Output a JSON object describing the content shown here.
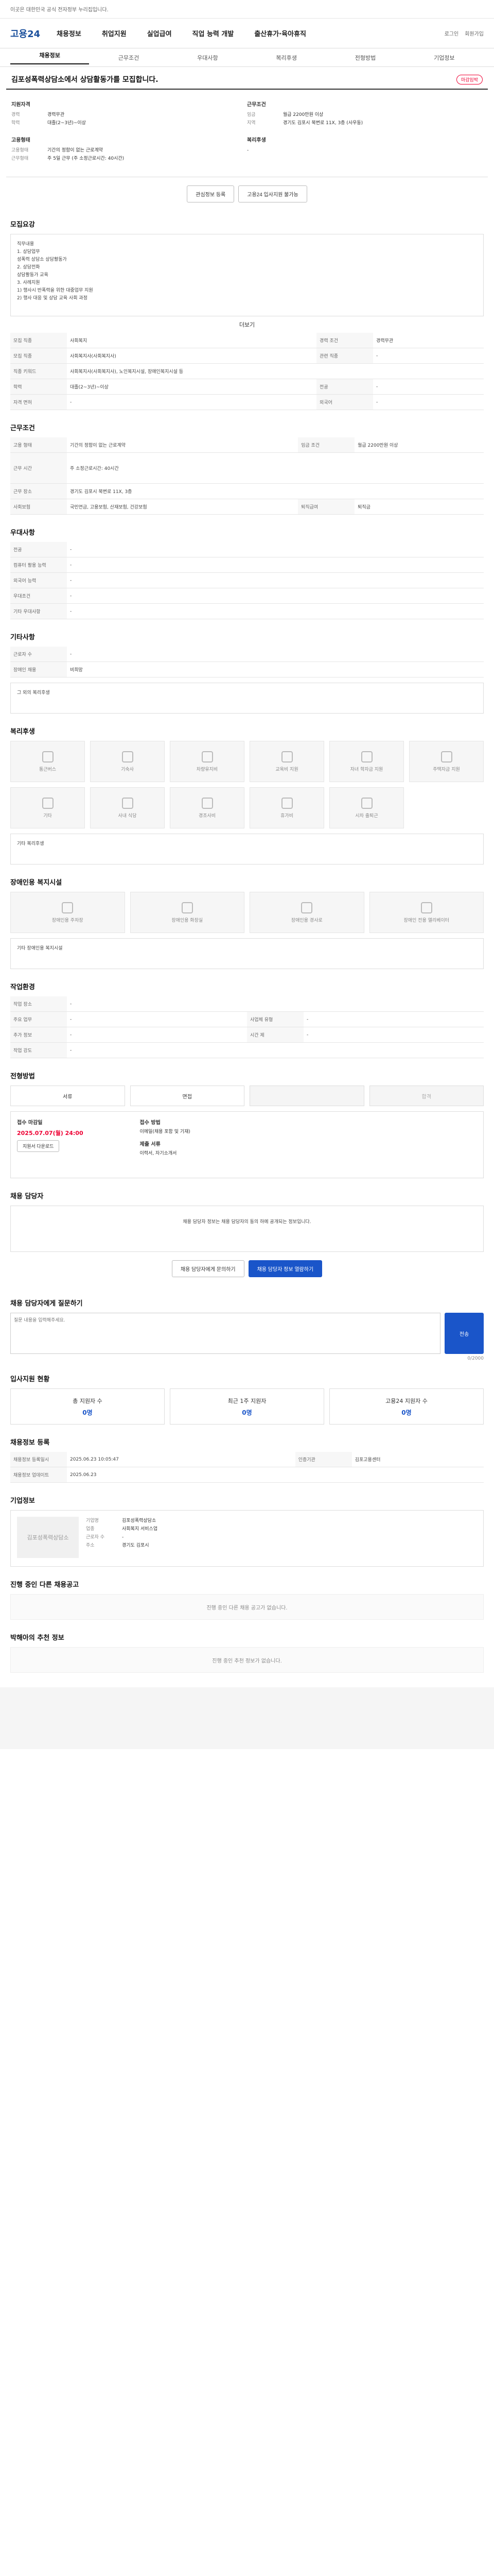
{
  "topbar": {
    "notice": "이곳은 대한민국 공식 전자정부 누리집입니다."
  },
  "site": {
    "logo": "고용24",
    "gnb": [
      "채용정보",
      "취업지원",
      "실업급여",
      "직업 능력 개발",
      "출산휴가·육아휴직"
    ],
    "links": [
      "로그인",
      "회원가입"
    ]
  },
  "tabs": [
    "채용정보",
    "근무조건",
    "우대사항",
    "복리후생",
    "전형방법",
    "기업정보"
  ],
  "job": {
    "title": "김포성폭력상담소에서 상담활동가를 모집합니다.",
    "badge": "마감임박",
    "company_h": "지원자격",
    "company_kv": [
      [
        "경력",
        "경력무관"
      ],
      [
        "학력",
        "대졸(2~3년)~이상"
      ]
    ],
    "cond_h": "근무조건",
    "cond_kv": [
      [
        "임금",
        "월급 2200만원 이상"
      ],
      [
        "지역",
        "경기도 김포시 북변로 11X, 3층 (사우동)"
      ]
    ],
    "emp_h": "고용형태",
    "emp_kv": [
      [
        "고용형태",
        "기간의 정함이 없는 근로계약"
      ],
      [
        "근무형태",
        "주 5일 근무 (주 소정근로시간: 40시간)"
      ]
    ],
    "welfare_h": "복리후생",
    "welfare_v": "-"
  },
  "actions": {
    "like": "관심정보 등록",
    "apply": "고용24 입사지원 불가능"
  },
  "recruit": {
    "h": "모집요강",
    "content": "직무내용\n1. 상담업무\n성폭력 상담소 상담활동가\n2. 상담전화\n상담활동가 교육\n3. 사례지원\n1) 행사시 반폭력을 위한 대중업무 지원\n2) 행사 대응 및 상담 교육 사회 과정",
    "more": "더보기",
    "rows": [
      [
        "모집 직종",
        "사회복지",
        "경력 조건",
        "경력무관"
      ],
      [
        "모집 직종",
        "사회복지사(사회복지사)",
        "관련 직종",
        "-"
      ],
      [
        "직종 키워드",
        "사회복지사(사회복지사), 노인복지시설, 장애인복지시설 등",
        "",
        ""
      ],
      [
        "학력",
        "대졸(2~3년)~이상",
        "전공",
        "-"
      ],
      [
        "자격 면허",
        "-",
        "외국어",
        "-"
      ]
    ]
  },
  "work": {
    "h": "근무조건",
    "rows": [
      [
        "고용 형태",
        "기간의 정함이 없는 근로계약",
        "임금 조건",
        "월급 2200만원 이상"
      ],
      [
        "근무 시간",
        "주 소정근로시간: 40시간",
        "",
        ""
      ],
      [
        "근무 장소",
        "경기도 김포시 북변로 11X, 3층",
        "",
        "",
        ""
      ],
      [
        "사회보험",
        "국민연금, 고용보험, 산재보험, 건강보험",
        "퇴직급여",
        "퇴직금"
      ]
    ]
  },
  "pref": {
    "h": "우대사항",
    "rows": [
      [
        "전공",
        "-"
      ],
      [
        "컴퓨터 활용 능력",
        "-"
      ],
      [
        "외국어 능력",
        "-"
      ],
      [
        "우대조건",
        "-"
      ],
      [
        "기타 우대사항",
        "-"
      ]
    ]
  },
  "etc": {
    "h": "기타사항",
    "rows": [
      [
        "근로자 수",
        "-"
      ],
      [
        "장애인 채용",
        "비희망"
      ]
    ],
    "note": "그 외의 복리후생"
  },
  "benefits": {
    "h": "복리후생",
    "items": [
      "통근버스",
      "기숙사",
      "차량유지비",
      "교육비 지원",
      "자녀 학자금 지원",
      "주택자금 지원",
      "기타",
      "사내 식당",
      "경조사비",
      "휴가비",
      "시차 출퇴근"
    ],
    "etc": "기타 복리후생"
  },
  "disabled": {
    "h": "장애인용 복지시설",
    "items": [
      "장애인용 주차장",
      "장애인용 화장실",
      "장애인용 경사로",
      "장애인 전용 엘리베이터"
    ],
    "etc": "기타 장애인용 복지시설"
  },
  "company_info": {
    "h": "작업환경",
    "rows": [
      [
        "작업 장소",
        "-",
        "",
        ""
      ],
      [
        "주요 업무",
        "-",
        "사업체 유형",
        "-"
      ],
      [
        "추가 정보",
        "-",
        "시간 제",
        "-"
      ],
      [
        "작업 강도",
        "-",
        "",
        ""
      ]
    ]
  },
  "process": {
    "h": "전형방법",
    "steps": [
      "서류",
      "면접",
      "",
      "합격"
    ],
    "apply_h": "접수 마감일",
    "deadline": "2025.07.07(월) 24:00",
    "method_h": "접수 방법",
    "method": "이메일(채용 포함 및 기재)",
    "docs_h": "제출 서류",
    "docs": "이력서, 자기소개서",
    "btn": "지원서 다운로드"
  },
  "manager": {
    "h": "채용 담당자",
    "info": "채용 담당자 정보는 채용 담당자의 동의 하에 공개되는 정보입니다.",
    "btn1": "채용 담당자에게 문의하기",
    "btn2": "채용 담당자 정보 열람하기"
  },
  "inquiry": {
    "h": "채용 담당자에게 질문하기",
    "placeholder": "질문 내용을 입력해주세요.",
    "submit": "전송",
    "count": "0/2000"
  },
  "status": {
    "h": "입사지원 현황",
    "items": [
      [
        "총 지원자 수",
        "0명"
      ],
      [
        "최근 1주 지원자",
        "0명"
      ],
      [
        "고용24 지원자 수",
        "0명"
      ]
    ]
  },
  "regist": {
    "h": "채용정보 등록",
    "rows": [
      [
        "채용정보 등록일시",
        "2025.06.23 10:05:47",
        "인증기관",
        "김포고용센터"
      ],
      [
        "채용정보 업데이트",
        "2025.06.23",
        "",
        "",
        ""
      ]
    ]
  },
  "corp": {
    "h": "기업정보",
    "name": "김포성폭력상담소",
    "rows": [
      [
        "기업명",
        "김포성폭력상담소"
      ],
      [
        "업종",
        "사회복지 서비스업"
      ],
      [
        "근로자 수",
        "-"
      ],
      [
        "주소",
        "경기도 김포시"
      ]
    ]
  },
  "similar": {
    "h": "진행 중인 다른 채용공고",
    "empty": "진행 중인 다른 채용 공고가 없습니다."
  },
  "recommend": {
    "h": "박해아의 추천 정보",
    "empty": "진행 중인 추천 정보가 없습니다."
  }
}
